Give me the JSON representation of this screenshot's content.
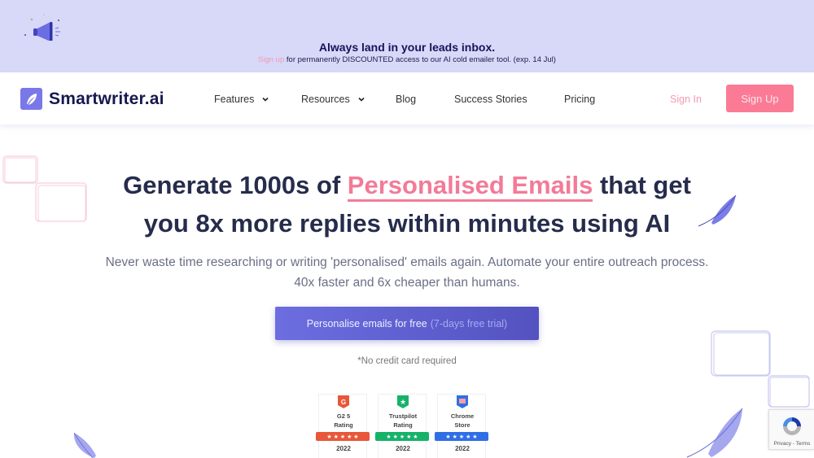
{
  "banner": {
    "title": "Always land in your leads inbox.",
    "link_text": "Sign up",
    "text": " for permanently DISCOUNTED access to our AI cold emailer tool. (exp. 14 Jul)",
    "icon": "megaphone-icon"
  },
  "nav": {
    "logo_text": "Smartwriter.ai",
    "items": [
      {
        "label": "Features",
        "has_dropdown": true
      },
      {
        "label": "Resources",
        "has_dropdown": true
      },
      {
        "label": "Blog",
        "has_dropdown": false
      },
      {
        "label": "Success Stories",
        "has_dropdown": false
      },
      {
        "label": "Pricing",
        "has_dropdown": false
      }
    ],
    "sign_in": "Sign In",
    "sign_up": "Sign Up"
  },
  "hero": {
    "title_part1": "Generate 1000s of ",
    "title_highlight": "Personalised Emails",
    "title_part2": " that get",
    "title_line2": "you 8x more replies within minutes using AI",
    "subtitle": "Never waste time researching or writing 'personalised' emails again. Automate your entire outreach process. 40x faster and 6x cheaper than humans.",
    "cta_label": "Personalise emails for free",
    "cta_trial": "(7-days free trial)",
    "note": "*No credit card required"
  },
  "badges": [
    {
      "line1": "G2 5",
      "line2": "Rating",
      "year": "2022",
      "color": "#e8573a",
      "icon": "g2-icon"
    },
    {
      "line1": "Trustpilot",
      "line2": "Rating",
      "year": "2022",
      "color": "#16b26a",
      "icon": "trustpilot-star-icon"
    },
    {
      "line1": "Chrome",
      "line2": "Store",
      "year": "2022",
      "color": "#2f6fe6",
      "icon": "chrome-store-icon"
    }
  ],
  "badge_stars": "★ ★ ★ ★ ★",
  "recaptcha": {
    "text": "Privacy - Terms"
  },
  "colors": {
    "accent_pink": "#fb7b96",
    "accent_purple": "#6c6ee0",
    "heading": "#262c4b",
    "banner_bg": "#d8d8f8"
  }
}
